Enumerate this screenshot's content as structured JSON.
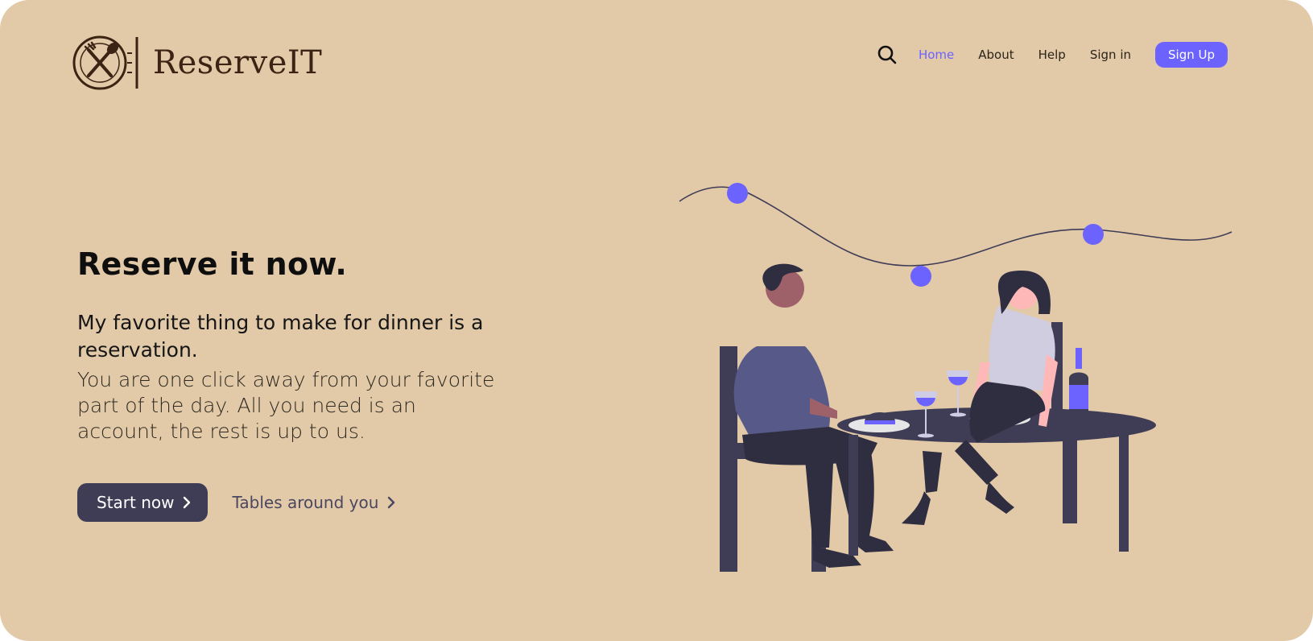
{
  "brand": {
    "name": "ReserveIT"
  },
  "nav": {
    "items": [
      {
        "label": "Home",
        "active": true
      },
      {
        "label": "About",
        "active": false
      },
      {
        "label": "Help",
        "active": false
      },
      {
        "label": "Sign in",
        "active": false
      }
    ],
    "signup_label": "Sign Up"
  },
  "hero": {
    "title": "Reserve it now.",
    "subtitle": "My favorite thing to make for dinner is a reservation.",
    "body": "You are one click away from your favorite part of the day. All you need is an account, the rest is up to us.",
    "cta_primary": "Start now",
    "cta_secondary": "Tables around you"
  },
  "icons": {
    "search": "search-icon",
    "logo": "fork-spoon-plate-icon",
    "chevron": "chevron-right-icon"
  },
  "colors": {
    "background": "#e2c9a8",
    "accent": "#6c63ff",
    "dark": "#3f3d56",
    "brand_text": "#3b2414"
  }
}
